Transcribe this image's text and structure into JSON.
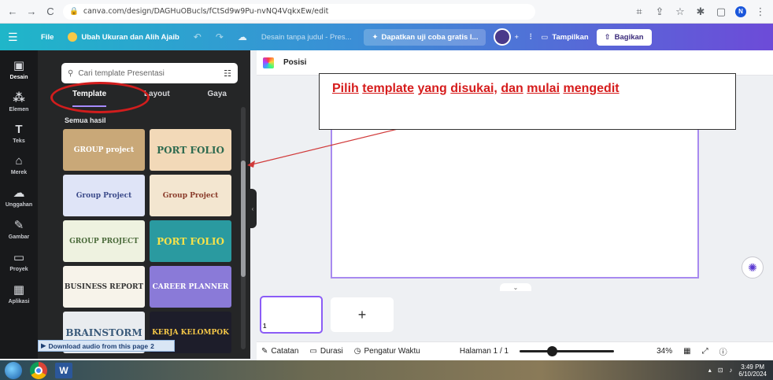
{
  "browser": {
    "url": "canva.com/design/DAGHuOBucls/fCtSd9w9Pu-nvNQ4VqkxEw/edit"
  },
  "topbar": {
    "file_label": "File",
    "resize_label": "Ubah Ukuran dan Alih Ajaib",
    "doc_title": "Desain tanpa judul - Pres...",
    "trial_label": "Dapatkan uji coba gratis l...",
    "present_label": "Tampilkan",
    "share_label": "Bagikan",
    "colors": {
      "start": "#1fb6c9",
      "end": "#6d4bd8"
    }
  },
  "rail": {
    "items": [
      {
        "label": "Desain",
        "icon": "layout-icon"
      },
      {
        "label": "Elemen",
        "icon": "shapes-icon"
      },
      {
        "label": "Teks",
        "icon": "text-icon"
      },
      {
        "label": "Merek",
        "icon": "brand-icon"
      },
      {
        "label": "Unggahan",
        "icon": "upload-icon"
      },
      {
        "label": "Gambar",
        "icon": "draw-icon"
      },
      {
        "label": "Proyek",
        "icon": "folder-icon"
      },
      {
        "label": "Aplikasi",
        "icon": "apps-icon"
      }
    ]
  },
  "panel": {
    "search_placeholder": "Cari template Presentasi",
    "tabs": [
      "Template",
      "Layout",
      "Gaya"
    ],
    "section_title": "Semua hasil",
    "templates": [
      {
        "text": "GROUP project",
        "bg": "#c9a878",
        "fg": "#fff"
      },
      {
        "text": "PORT FOLIO",
        "bg": "#f2d9b8",
        "fg": "#2d6a4f"
      },
      {
        "text": "Group Project",
        "bg": "#dfe4f7",
        "fg": "#3b4a8a"
      },
      {
        "text": "Group Project",
        "bg": "#f3e6d0",
        "fg": "#8a3b2a"
      },
      {
        "text": "GROUP PROJECT",
        "bg": "#eef2e0",
        "fg": "#4a6a3a"
      },
      {
        "text": "PORT FOLIO",
        "bg": "#2a9aa0",
        "fg": "#f7e24a"
      },
      {
        "text": "BUSINESS REPORT",
        "bg": "#f7f3ea",
        "fg": "#333"
      },
      {
        "text": "CAREER PLANNER",
        "bg": "#8a7ad8",
        "fg": "#fff"
      },
      {
        "text": "BRAINSTORM",
        "bg": "#e9ecef",
        "fg": "#3a5a7a"
      },
      {
        "text": "KERJA KELOMPOK",
        "bg": "#1d1d2a",
        "fg": "#f7c948"
      }
    ],
    "download_label": "Download audio from this page",
    "download_count": "2"
  },
  "editor": {
    "position_label": "Posisi",
    "callout_parts": [
      "Pilih",
      "template",
      "yang",
      "disukai,",
      "dan",
      "mulai",
      "mengedit"
    ],
    "page_number": "1",
    "add_page": "+"
  },
  "bottombar": {
    "notes": "Catatan",
    "duration": "Durasi",
    "timer": "Pengatur Waktu",
    "page_info": "Halaman 1 / 1",
    "zoom": "34%",
    "zoom_fraction": 0.34
  },
  "taskbar": {
    "time": "3:49 PM",
    "date": "6/10/2024",
    "word_label": "W"
  }
}
